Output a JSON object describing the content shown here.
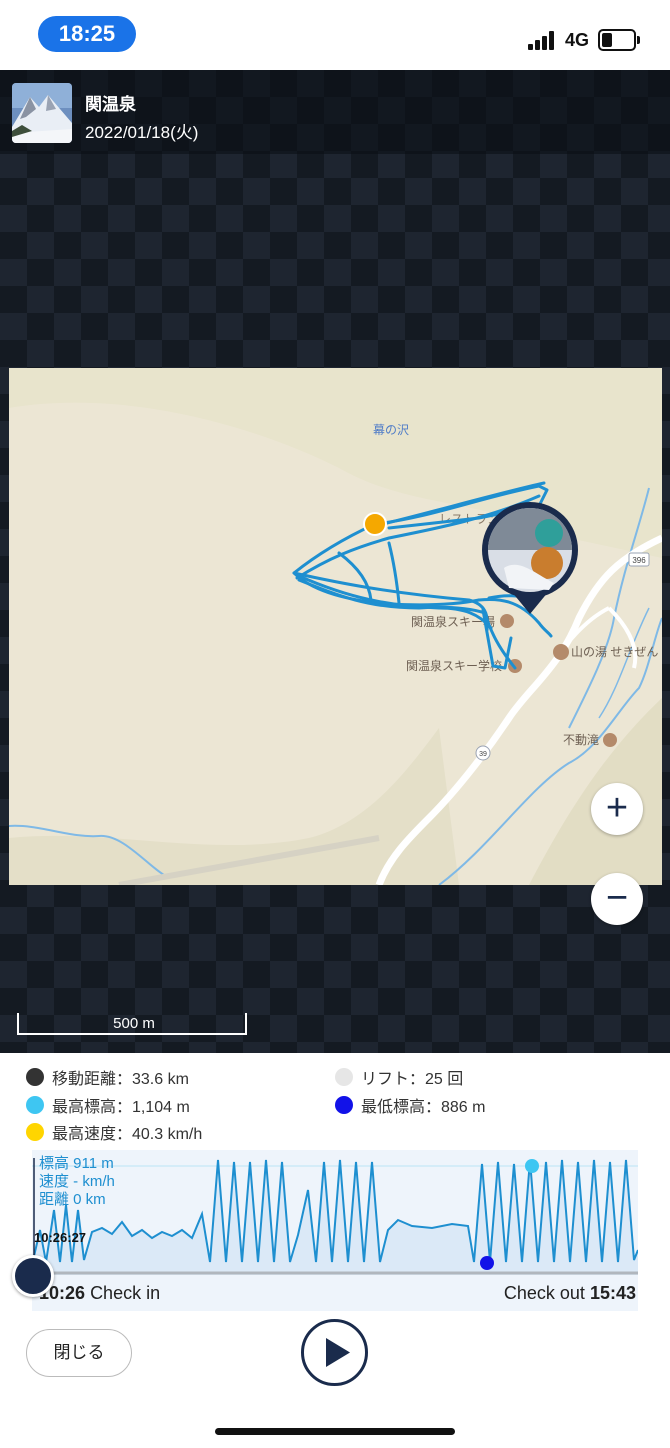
{
  "status": {
    "time": "18:25",
    "network": "4G",
    "battery_level": 0.3,
    "signal_bars": 4
  },
  "header": {
    "place": "関温泉",
    "date": "2022/01/18(火)"
  },
  "map": {
    "labels": {
      "area": "幕の沢",
      "restaurant": "レストラン",
      "ski_area": "関温泉スキー場",
      "ski_school": "関温泉スキー学校",
      "onsen": "山の湯 せきぜん",
      "waterfall": "不動滝",
      "route_396": "396",
      "route_39": "39"
    },
    "zoom_in": "+",
    "zoom_out": "−",
    "scale": "500 m"
  },
  "stats": {
    "distance": "移動距離：33.6 km",
    "lift": "リフト：25 回",
    "max_altitude": "最高標高：1,104 m",
    "min_altitude": "最低標高：886 m",
    "max_speed": "最高速度：40.3 km/h"
  },
  "colors": {
    "distance": "#333333",
    "lift": "#e6e6e6",
    "max_altitude": "#3ec6f2",
    "min_altitude": "#1212e8",
    "max_speed": "#ffd500",
    "track": "#1e8fd0",
    "accent": "#1a2b4c"
  },
  "profile": {
    "altitude": "標高 911 m",
    "speed": "速度 - km/h",
    "distance": "距離 0 km",
    "cursor_time": "10:26:27",
    "checkin_time": "10:26",
    "checkin_label": "Check in",
    "checkout_label": "Check out",
    "checkout_time": "15:43"
  },
  "buttons": {
    "close": "閉じる",
    "play": "play-icon"
  }
}
